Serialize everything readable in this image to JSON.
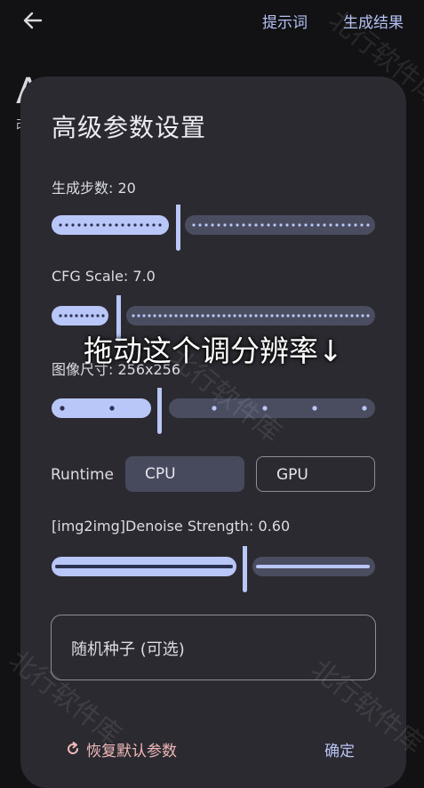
{
  "topbar": {
    "tab_prompt": "提示词",
    "tab_result": "生成结果"
  },
  "background": {
    "title_letter": "A",
    "subtitle_char": "改"
  },
  "dialog": {
    "title": "高级参数设置",
    "steps": {
      "label": "生成步数: 20",
      "value": 20,
      "min": 1,
      "max": 50
    },
    "cfg": {
      "label": "CFG Scale: 7.0",
      "value": 7.0,
      "min": 1,
      "max": 30
    },
    "resolution": {
      "label": "图像尺寸: 256x256",
      "value_index": 1,
      "stops": 6
    },
    "runtime": {
      "label": "Runtime",
      "options": [
        "CPU",
        "GPU"
      ],
      "selected": "CPU"
    },
    "denoise": {
      "label": "[img2img]Denoise Strength: 0.60",
      "value": 0.6
    },
    "seed": {
      "placeholder": "随机种子 (可选)"
    },
    "reset_label": "恢复默认参数",
    "confirm_label": "确定"
  },
  "overlay": {
    "instruction": "拖动这个调分辨率↓"
  },
  "watermark": "北行软件库",
  "colors": {
    "accent": "#b8c6f8",
    "track_inactive": "#4a4d60",
    "dialog_bg": "#2a2a30",
    "reset": "#f0b8b8"
  }
}
